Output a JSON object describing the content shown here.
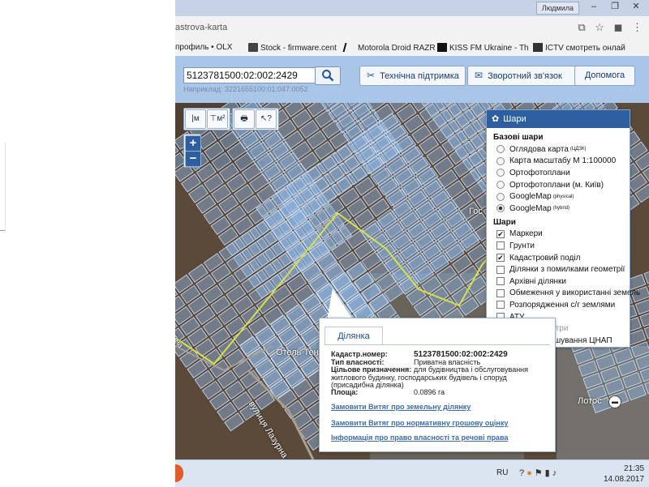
{
  "browser": {
    "user_label": "Людмила",
    "url": "astrova-karta",
    "bookmarks": [
      {
        "label": "профиль • OLX"
      },
      {
        "label": "Stock - firmware.cent"
      },
      {
        "label": "Motorola Droid RAZR"
      },
      {
        "label": "KISS FM Ukraine - Th"
      },
      {
        "label": "ICTV смотреть онлай"
      }
    ]
  },
  "header": {
    "search_value": "5123781500:02:002:2429",
    "search_hint": "Наприклад: 3221655100:01:047:0052",
    "support_label": "Технічна підтримка",
    "feedback_label": "Зворотний зв'язок",
    "help_label": "Допомога"
  },
  "map": {
    "tool_m": "м",
    "tool_m2": "м²",
    "zoom_in": "+",
    "zoom_out": "−",
    "labels": {
      "hotel": "Отель Тен",
      "street": "вулиця Лазурна",
      "lotos": "Лотос",
      "gost": "Гос",
      "arna": "арна"
    }
  },
  "layers": {
    "title": "Шари",
    "base_title": "Базові шари",
    "base": [
      {
        "label": "Оглядова карта",
        "sup": "(ЦДЗК)",
        "selected": false
      },
      {
        "label": "Карта масштабу М 1:100000",
        "sup": "",
        "selected": false
      },
      {
        "label": "Ортофотоплани",
        "sup": "",
        "selected": false
      },
      {
        "label": "Ортофотоплани (м. Київ)",
        "sup": "",
        "selected": false
      },
      {
        "label": "GoogleMap",
        "sup": "(physical)",
        "selected": false
      },
      {
        "label": "GoogleMap",
        "sup": "(hybrid)",
        "selected": true
      }
    ],
    "overlay_title": "Шари",
    "overlays": [
      {
        "label": "Маркери",
        "checked": true,
        "disabled": false
      },
      {
        "label": "Грунти",
        "checked": false,
        "disabled": false
      },
      {
        "label": "Кадастровий поділ",
        "checked": true,
        "disabled": false
      },
      {
        "label": "Ділянки з помилками геометрії",
        "checked": false,
        "disabled": false
      },
      {
        "label": "Архівні ділянки",
        "checked": false,
        "disabled": false
      },
      {
        "label": "Обмеження у використанні земель",
        "checked": false,
        "disabled": false
      },
      {
        "label": "Розпорядження с/г землями",
        "checked": false,
        "disabled": false
      },
      {
        "label": "АТУ",
        "checked": false,
        "disabled": false
      },
      {
        "label": "Обласні центри",
        "checked": false,
        "disabled": true
      },
      {
        "label": "Місце розташування ЦНАП",
        "checked": false,
        "disabled": false
      }
    ]
  },
  "popup": {
    "tab": "Ділянка",
    "cadastr_label": "Кадастр.номер:",
    "cadastr_value": "5123781500:02:002:2429",
    "ownership_label": "Тип власності:",
    "ownership_value": "Приватна власність",
    "purpose_label": "Цільове призначення:",
    "purpose_value_1": "для будівництва і обслуговування",
    "purpose_value_2": "житлового будинку, господарських будівель і споруд",
    "purpose_value_3": "(присадибна ділянка)",
    "area_label": "Площа:",
    "area_value": "0.0896 га",
    "link1": "Замовити Витяг про земельну ділянку",
    "link2": "Замовити Витяг про нормативну грошову оцінку",
    "link3": "Інформація про право власності та речові права"
  },
  "taskbar": {
    "lang": "RU",
    "time": "21:35",
    "date": "14.08.2017"
  },
  "colors": {
    "header_bg": "#a9c5e8",
    "panel_header": "#2d5fa0",
    "parcel_fill": "#8fb8e6",
    "link": "#3e6bb4"
  }
}
